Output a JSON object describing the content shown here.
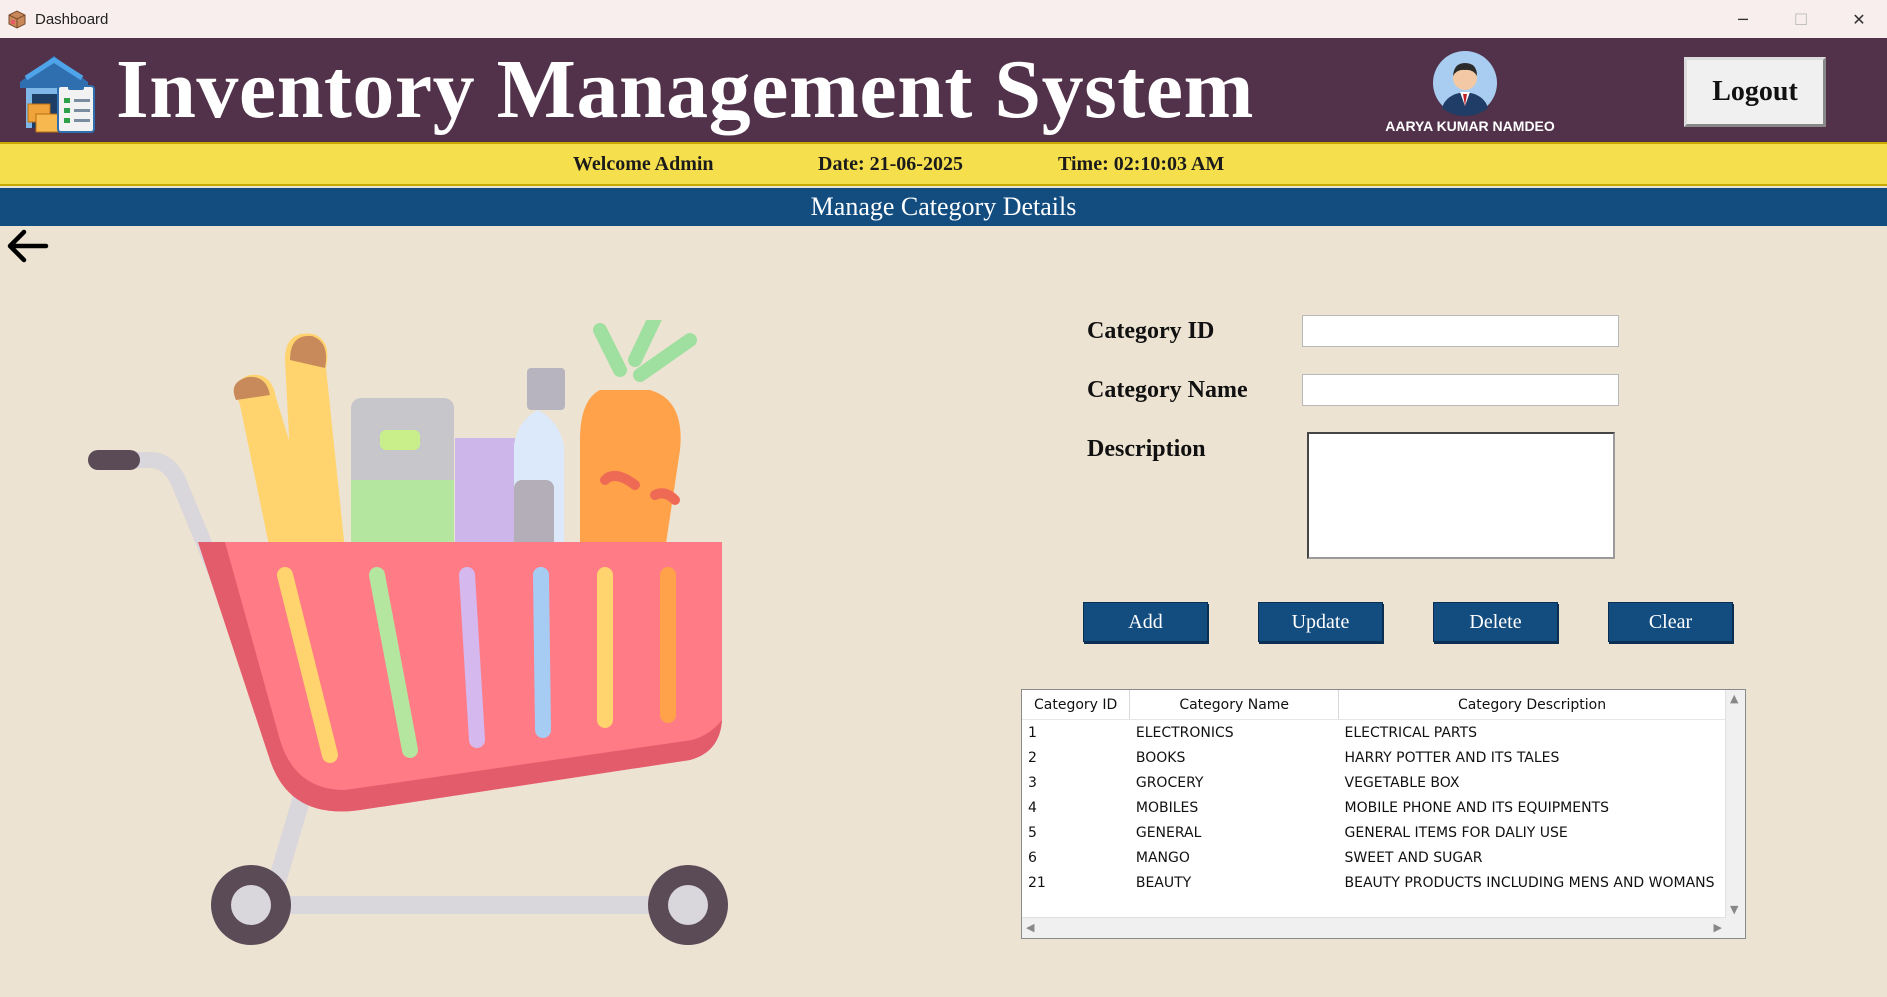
{
  "window": {
    "title": "Dashboard",
    "controls": {
      "minimize_icon": "─",
      "maximize_icon": "☐",
      "close_icon": "✕"
    }
  },
  "header": {
    "app_title": "Inventory Management System",
    "user_name": "AARYA KUMAR NAMDEO",
    "logout_label": "Logout"
  },
  "infobar": {
    "welcome": "Welcome Admin",
    "date": "Date: 21-06-2025",
    "time": "Time: 02:10:03 AM"
  },
  "section": {
    "title": "Manage Category Details"
  },
  "form": {
    "category_id_label": "Category ID",
    "category_name_label": "Category Name",
    "description_label": "Description",
    "category_id_value": "",
    "category_name_value": "",
    "description_value": ""
  },
  "buttons": {
    "add": "Add",
    "update": "Update",
    "delete": "Delete",
    "clear": "Clear"
  },
  "table": {
    "headers": [
      "Category ID",
      "Category Name",
      "Category Description"
    ],
    "rows": [
      [
        "1",
        "ELECTRONICS",
        "ELECTRICAL PARTS"
      ],
      [
        "2",
        "BOOKS",
        "HARRY POTTER AND ITS TALES"
      ],
      [
        "3",
        "GROCERY",
        "VEGETABLE BOX"
      ],
      [
        "4",
        "MOBILES",
        "MOBILE PHONE AND ITS EQUIPMENTS"
      ],
      [
        "5",
        "GENERAL",
        "GENERAL ITEMS FOR DALIY USE"
      ],
      [
        "6",
        "MANGO",
        "SWEET AND SUGAR"
      ],
      [
        "21",
        "BEAUTY",
        "BEAUTY PRODUCTS INCLUDING MENS AND WOMANS"
      ]
    ]
  },
  "colors": {
    "header_bg": "#52324a",
    "infobar_bg": "#f6df4c",
    "section_bg": "#134d80",
    "button_bg": "#134d80",
    "page_bg": "#ede3d2"
  },
  "icons": {
    "app_icon": "inventory-box-icon",
    "logo": "warehouse-clipboard-icon",
    "avatar": "user-avatar-icon",
    "back": "back-arrow-icon",
    "illustration": "shopping-cart-illustration"
  }
}
